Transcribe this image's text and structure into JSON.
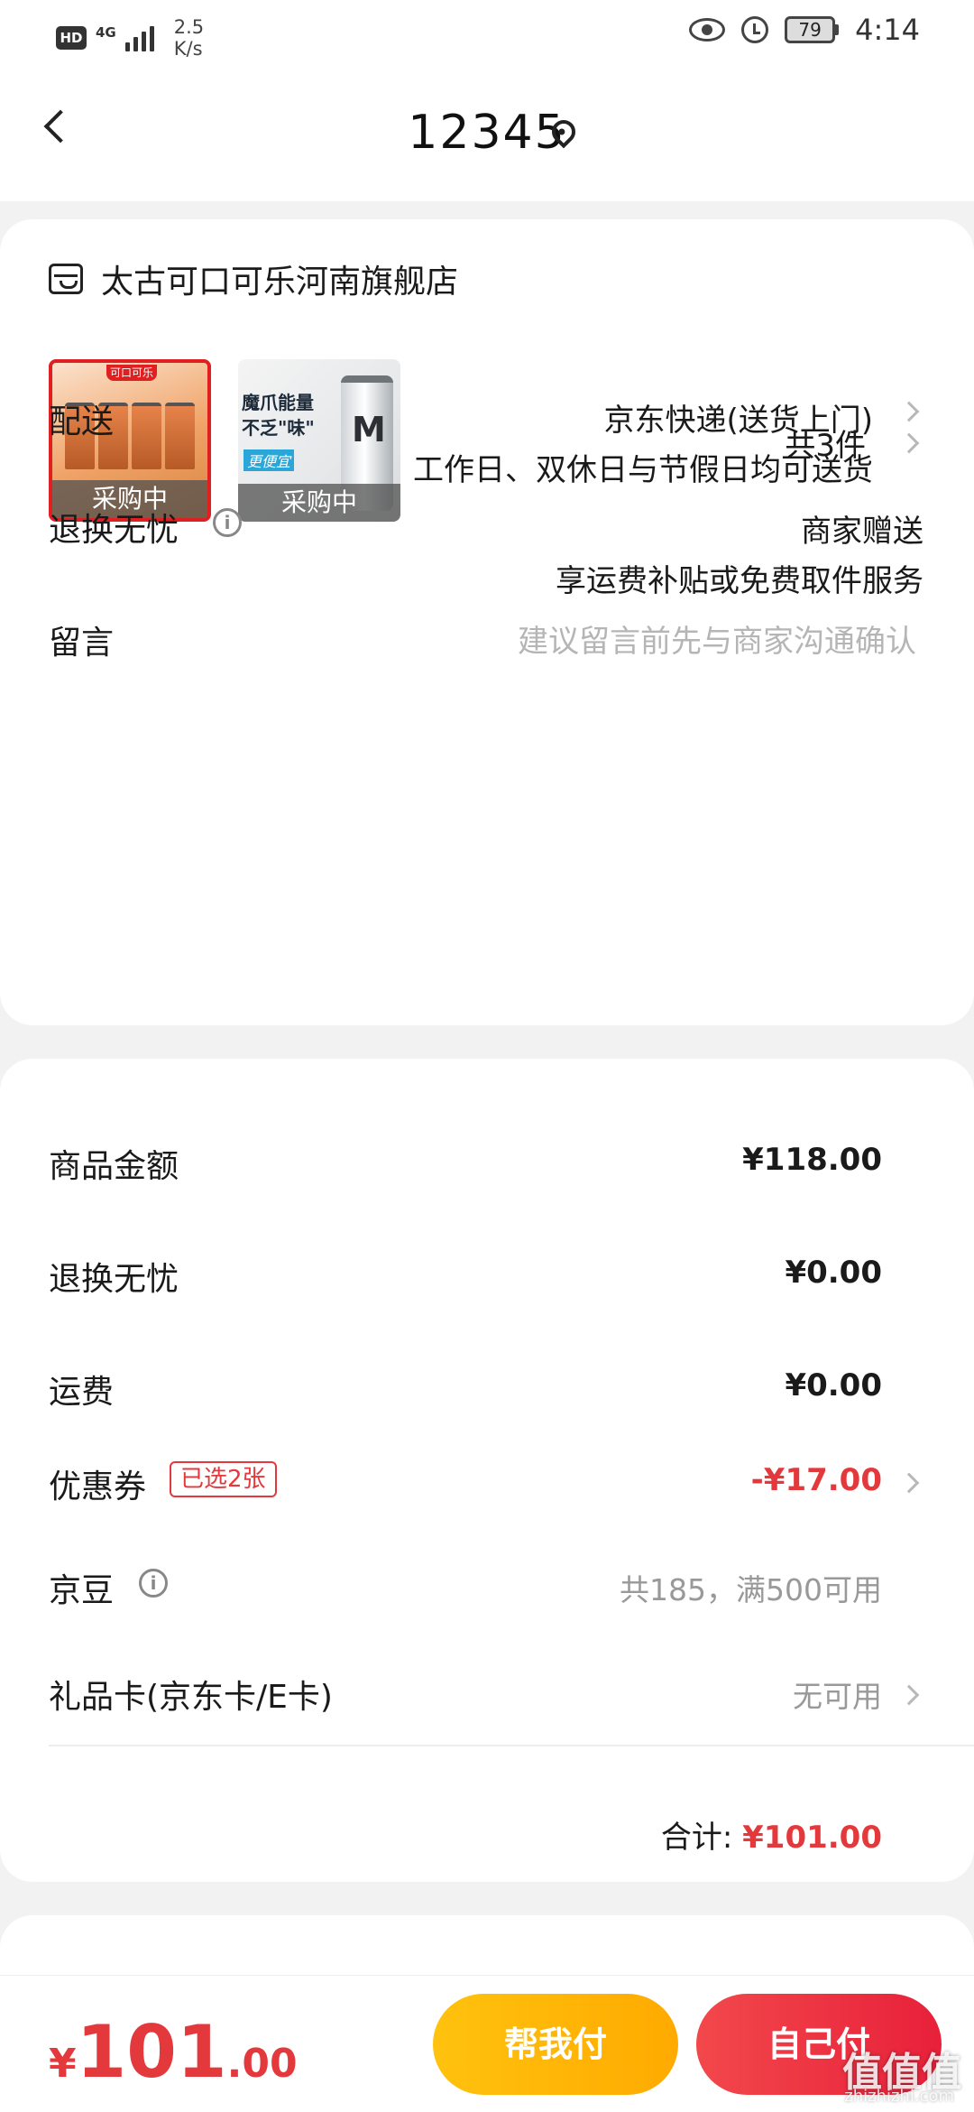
{
  "status_bar": {
    "hd": "HD",
    "network": "4G",
    "speed_value": "2.5",
    "speed_unit": "K/s",
    "battery": "79",
    "time": "4:14"
  },
  "header": {
    "title": "12345"
  },
  "store": {
    "name": "太古可口可乐河南旗舰店",
    "products": [
      {
        "status": "采购中",
        "brand_text": "可口可乐"
      },
      {
        "status": "采购中",
        "promo_title": "魔爪能量 不乏\"味\"",
        "promo_tag": "更便宜"
      }
    ],
    "count": "共3件"
  },
  "delivery": {
    "label": "配送",
    "method": "京东快递(送货上门)",
    "schedule": "工作日、双休日与节假日均可送货"
  },
  "return_service": {
    "label": "退换无忧",
    "provider": "商家赠送",
    "detail": "享运费补贴或免费取件服务"
  },
  "message": {
    "label": "留言",
    "placeholder": "建议留言前先与商家沟通确认"
  },
  "summary": {
    "goods_label": "商品金额",
    "goods_amount": "¥118.00",
    "return_label": "退换无忧",
    "return_amount": "¥0.00",
    "shipping_label": "运费",
    "shipping_amount": "¥0.00",
    "coupon_label": "优惠券",
    "coupon_badge": "已选2张",
    "coupon_amount": "-¥17.00",
    "jingdou_label": "京豆",
    "jingdou_text": "共185，满500可用",
    "giftcard_label": "礼品卡(京东卡/E卡)",
    "giftcard_text": "无可用",
    "total_label": "合计:",
    "total_amount": "¥101.00"
  },
  "bottom": {
    "yen": "¥",
    "price_int": "101",
    "price_dec": ".00",
    "help_pay": "帮我付",
    "self_pay": "自己付",
    "watermark": "值值值",
    "watermark_sub": "zhizhizhi.com"
  },
  "colors": {
    "accent_red": "#e4393c",
    "help_button": "#ffb300",
    "self_button": "#ec2e40"
  }
}
